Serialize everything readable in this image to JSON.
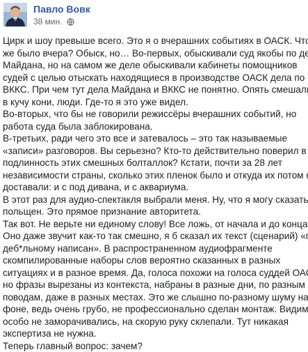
{
  "post": {
    "author": "Павло Вовк",
    "time": "38 мин.",
    "lines": [
      "Цирк и шоу превыше всего. Это я о вчерашних событиях в ОАСК. Что",
      "же было вчера? Обыск, но… Во-первых, обыскивали суд якобы по делу",
      "Майдана, но на самом же деле обыскивали кабинеты помощников",
      "судей с целью отыскать находящиеся в производстве ОАСК дела по",
      "ВККС. При чем тут дела Майдана и ВККС не понятно. Опять смешались",
      "в кучу кони, люди. Где-то я это уже видел.",
      "Во-вторых, что бы не говорили режиссёры вчерашних событий, но",
      "работа суда была заблокирована.",
      "В-третьих, ради чего это все и затевалось – это так называемые",
      "«записи» разговоров. Вы серьезно? Кто-то действительно поверил в",
      "подлинность этих смешных болталлок? Кстати, почти за 28 лет",
      "независимости страны, сколько этих пленок было и откуда их потом не",
      "доставали: и с под дивана, и с аквариума.",
      "В этот раз для аудио-спектакля выбрали меня. Ну, что я могу сказать? Я",
      "польщен. Это прямое признание авторитета.",
      "Так вот. Не верьте ни единому слову! Все ложь, от начала и до конца.",
      "Оно даже звучит как-то так смешно, я б сказал их текст (сценарий) «по-",
      "деб*льному написан». В распространенном аудиофрагменте",
      "скомпилированные наборы слов вероятно сказанных в разных",
      "ситуациях и в разное время. Да, голоса похожи на голоса суддей ОАСК,",
      "но фразы вырезаны из контекста, набраны в разные дни, по разным",
      "поводам, даже в разных местах. Это же слышно по-разному шуму на",
      "фоне, ведь очень грубо, не профессионально сделан монтаж. Видимо,",
      "особо не заморачивались, на скорую руку склепали. Тут никакая",
      "экспертиза не нужна.",
      "Теперь главный вопрос: зачем?"
    ]
  },
  "icons": {
    "avatar": "author-avatar-photo",
    "privacy": "globe-icon"
  },
  "colors": {
    "author_link": "#385898",
    "meta_text": "#616770",
    "body_text": "#1c1e21"
  }
}
